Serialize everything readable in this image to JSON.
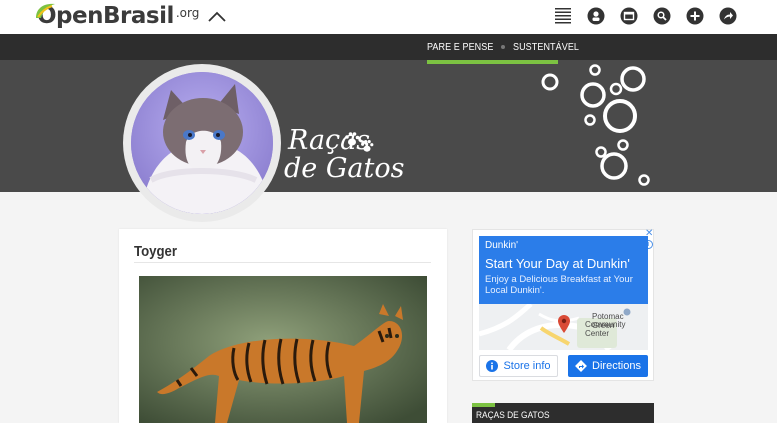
{
  "header": {
    "logo_text": "OpenBrasil",
    "logo_suffix": ".org",
    "icons": [
      "chevron-up-icon",
      "list-icon",
      "user-icon",
      "mail-icon",
      "search-icon",
      "plus-icon",
      "share-icon"
    ]
  },
  "nav": {
    "items": [
      "Pare e Pense",
      "Sustentável"
    ]
  },
  "banner": {
    "title_line1": "Raças",
    "title_line2": "de Gatos"
  },
  "post": {
    "title": "Toyger"
  },
  "ad": {
    "brand": "Dunkin'",
    "headline": "Start Your Day at Dunkin'",
    "description": "Enjoy a Delicious Breakfast at Your Local Dunkin'.",
    "map_label_line1": "Potomac Green",
    "map_label_line2": "Community Center",
    "store_button": "Store info",
    "directions_button": "Directions",
    "close": "✕",
    "info": "i"
  },
  "sidebar": {
    "widget_title": "Raças de Gatos"
  },
  "colors": {
    "accent": "#7cc242",
    "dark": "#2d2d2d",
    "banner": "#4a4a4a",
    "ad_blue": "#2b7de9"
  }
}
